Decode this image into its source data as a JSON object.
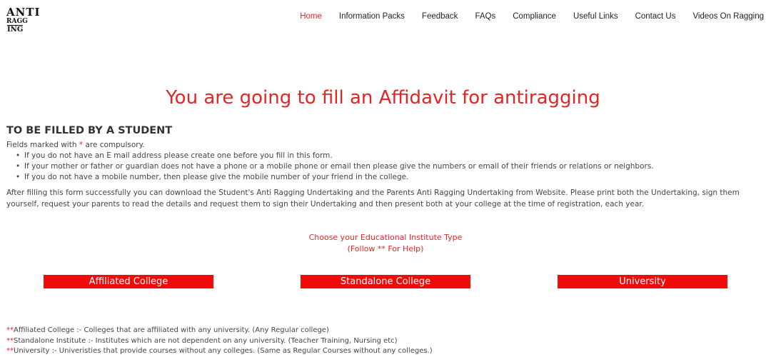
{
  "logo": {
    "top_text": "ANTI",
    "bottom_left": "RAGG",
    "bottom_right": "ING"
  },
  "nav": {
    "items": [
      {
        "label": "Home",
        "active": true
      },
      {
        "label": "Information Packs",
        "active": false
      },
      {
        "label": "Feedback",
        "active": false
      },
      {
        "label": "FAQs",
        "active": false
      },
      {
        "label": "Compliance",
        "active": false
      },
      {
        "label": "Useful Links",
        "active": false
      },
      {
        "label": "Contact Us",
        "active": false
      },
      {
        "label": "Videos On Ragging",
        "active": false
      }
    ]
  },
  "main": {
    "title": "You are going to fill an Affidavit for antiragging",
    "subtitle": "TO BE FILLED BY A STUDENT",
    "fields_note": {
      "before": "Fields marked with ",
      "star": "*",
      "after": " are compulsory."
    },
    "bullets": [
      "If you do not have an E mail address please create one before you fill in this form.",
      "If your mother or father or guardian does not have a phone or a mobile phone or email then please give the numbers or email of their friends or relations or neighbors.",
      "If you do not have a mobile number, then please give the mobile number of your friend in the college."
    ],
    "info_paragraph": "After filling this form successfully you can download the Student's Anti Ragging Undertaking and the Parents Anti Ragging Undertaking from Website. Please print both the Undertaking, sign them yourself, request your parents to read the details and request them to sign their Undertaking and then present both at your college at the time of registration, each year.",
    "choose_line1": "Choose your Educational Institute Type",
    "choose_line2": "(Follow ** For Help)"
  },
  "institute_buttons": {
    "affiliated": "Affiliated College",
    "standalone": "Standalone College",
    "university": "University"
  },
  "help": [
    {
      "stars": "**",
      "text": "Affiliated College :- Colleges that are affiliated with any university. (Any Regular college)"
    },
    {
      "stars": "**",
      "text": "Standalone Institute :- Institutes which are not dependent on any university. (Teacher Training, Nursing etc)"
    },
    {
      "stars": "**",
      "text": "University :- Univeristies that provide courses without any colleges. (Same as Regular Courses without any colleges.)"
    }
  ],
  "colors": {
    "accent": "#e52524",
    "button": "#f00a0a"
  }
}
